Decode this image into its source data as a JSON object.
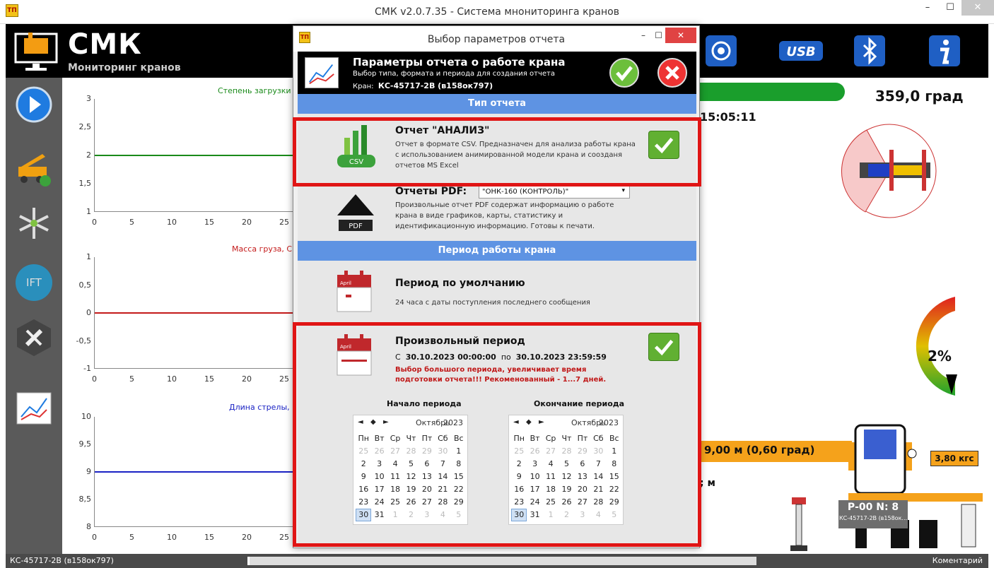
{
  "window": {
    "title": "СМК v2.0.7.35 - Система мнониторинга кранов",
    "app_icon": "ТП"
  },
  "header": {
    "logo_title": "СМК",
    "logo_subtitle": "Мониторинг кранов"
  },
  "toolbar_icons": [
    "target-icon",
    "usb-icon",
    "bluetooth-icon",
    "info-icon"
  ],
  "toolbar": {
    "usb_label": "USB"
  },
  "sidebar_icons": [
    "play-icon",
    "crane-icon",
    "snowflake-icon",
    "ift-icon",
    "wrench-icon",
    "chart-icon"
  ],
  "sidebar": {
    "ift_label": "IFT"
  },
  "charts": [
    {
      "title": "Степень загрузки",
      "y_ticks": [
        "3",
        "2,5",
        "2",
        "1,5",
        "1"
      ],
      "x_ticks": [
        "0",
        "5",
        "10",
        "15",
        "20",
        "25"
      ],
      "value": 2,
      "color": "#1a8a1a"
    },
    {
      "title": "Масса груза, С",
      "y_ticks": [
        "1",
        "0,5",
        "0",
        "-0,5",
        "-1"
      ],
      "x_ticks": [
        "0",
        "5",
        "10",
        "15",
        "20",
        "25"
      ],
      "value": 0,
      "color": "#c41a1a"
    },
    {
      "title": "Длина стрелы,",
      "y_ticks": [
        "10",
        "9,5",
        "9",
        "8,5",
        "8"
      ],
      "x_ticks": [
        "0",
        "5",
        "10",
        "15",
        "20",
        "25"
      ],
      "value": 9,
      "color": "#1a22c4"
    }
  ],
  "right": {
    "degree": "359,0 град",
    "time": "15:05:11",
    "percent": "2%",
    "boom": "9,00 м (0,60 град)",
    "load": "3,80 кгс",
    "meters": "; м",
    "pn": "Р-00  N: 8",
    "crane_small": "КС-45717-2В (в158ок..."
  },
  "status": {
    "left": "КС-45717-2В (в158ок797)",
    "right": "Коментарий"
  },
  "dialog": {
    "title": "Выбор параметров отчета",
    "app_icon": "ТП",
    "header_title": "Параметры отчета о работе крана",
    "header_sub": "Выбор типа, формата и периода для создания отчета",
    "header_crane_label": "Кран:",
    "header_crane": "КС-45717-2В (в158ок797)",
    "section_type": "Тип отчета",
    "analysis_title": "Отчет \"АНАЛИЗ\"",
    "analysis_desc": "Отчет в формате CSV. Предназначен для анализа работы крана с использованием анимированной модели крана и соозданя отчетов MS Excel",
    "analysis_icon_label": "CSV",
    "pdf_title": "Отчеты PDF:",
    "pdf_select": "\"ОНК-160 (КОНТРОЛЬ)\"",
    "pdf_desc": "Произвольные отчет PDF содержат информацию о работе крана в виде графиков, карты, статистику и идентификационную информацию. Готовы к печати.",
    "pdf_icon_label": "PDF",
    "section_period": "Период работы крана",
    "default_title": "Период по умолчанию",
    "default_desc": "24 часа с даты поступления последнего сообщения",
    "calendar_icon_label": "April",
    "custom_title": "Произвольный период",
    "custom_from_prefix": "С",
    "custom_from": "30.10.2023 00:00:00",
    "custom_to_prefix": "по",
    "custom_to": "30.10.2023 23:59:59",
    "custom_warning": "Выбор большого периода, увеличивает время подготовки отчета!!! Рекоменованный - 1...7 дней.",
    "start_label": "Начало периода",
    "end_label": "Окончание периода",
    "calendar": {
      "month": "Октябрь",
      "year": "2023",
      "weekdays": [
        "Пн",
        "Вт",
        "Ср",
        "Чт",
        "Пт",
        "Сб",
        "Вс"
      ],
      "days": [
        "25",
        "26",
        "27",
        "28",
        "29",
        "30",
        "1",
        "2",
        "3",
        "4",
        "5",
        "6",
        "7",
        "8",
        "9",
        "10",
        "11",
        "12",
        "13",
        "14",
        "15",
        "16",
        "17",
        "18",
        "19",
        "20",
        "21",
        "22",
        "23",
        "24",
        "25",
        "26",
        "27",
        "28",
        "29",
        "30",
        "31",
        "1",
        "2",
        "3",
        "4",
        "5"
      ],
      "dim_indexes": [
        0,
        1,
        2,
        3,
        4,
        5,
        37,
        38,
        39,
        40,
        41
      ],
      "selected_index": 35
    }
  }
}
